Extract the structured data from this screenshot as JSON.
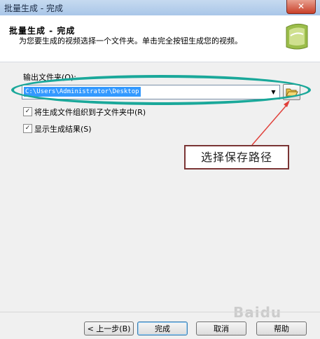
{
  "window": {
    "title": "批量生成 - 完成",
    "close_glyph": "✕"
  },
  "header": {
    "title": "批量生成 - 完成",
    "subtitle": "为您要生成的视频选择一个文件夹。单击完全按钮生成您的视频。"
  },
  "output": {
    "label": "输出文件夹(O):",
    "path": "C:\\Users\\Administrator\\Desktop"
  },
  "options": [
    {
      "label": "将生成文件组织到子文件夹中(R)",
      "checked": true
    },
    {
      "label": "显示生成结果(S)",
      "checked": true
    }
  ],
  "annotation": {
    "text": "选择保存路径",
    "color": "#7a3434"
  },
  "buttons": {
    "back": "< 上一步(B)",
    "finish": "完成",
    "cancel": "取消",
    "help": "帮助"
  },
  "watermark": "Baidu",
  "colors": {
    "highlight": "#3399ff",
    "ellipse": "#1aa89a",
    "arrow": "#e0403a"
  },
  "icons": {
    "close": "close-icon",
    "browse": "folder-open-icon",
    "dropdown": "chevron-down-icon",
    "logo": "film-logo-icon"
  }
}
